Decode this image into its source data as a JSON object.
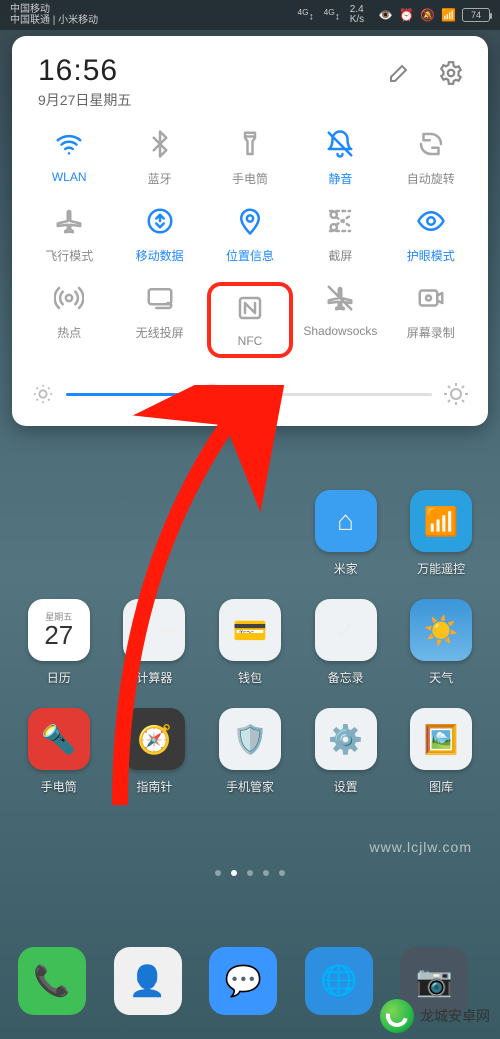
{
  "statusbar": {
    "carrier1": "中国移动",
    "carrier2": "中国联通 | 小米移动",
    "net1": "4G",
    "net2": "4G",
    "speed": "2.4",
    "speed_unit": "K/s",
    "battery": "74"
  },
  "panel": {
    "time": "16:56",
    "date": "9月27日星期五"
  },
  "tiles": [
    {
      "id": "wifi",
      "label": "WLAN",
      "icon": "wifi",
      "active": true
    },
    {
      "id": "bt",
      "label": "蓝牙",
      "icon": "bluetooth",
      "active": false
    },
    {
      "id": "torch",
      "label": "手电筒",
      "icon": "flashlight",
      "active": false
    },
    {
      "id": "mute",
      "label": "静音",
      "icon": "bell-off",
      "active": true
    },
    {
      "id": "rotate",
      "label": "自动旋转",
      "icon": "rotate",
      "active": false
    },
    {
      "id": "airplane",
      "label": "飞行模式",
      "icon": "airplane",
      "active": false
    },
    {
      "id": "data",
      "label": "移动数据",
      "icon": "data",
      "active": true
    },
    {
      "id": "location",
      "label": "位置信息",
      "icon": "location",
      "active": true
    },
    {
      "id": "screenshot",
      "label": "截屏",
      "icon": "scissors",
      "active": false
    },
    {
      "id": "eyecare",
      "label": "护眼模式",
      "icon": "eye",
      "active": true
    },
    {
      "id": "hotspot",
      "label": "热点",
      "icon": "hotspot",
      "active": false
    },
    {
      "id": "cast",
      "label": "无线投屏",
      "icon": "cast",
      "active": false
    },
    {
      "id": "nfc",
      "label": "NFC",
      "icon": "nfc",
      "active": false,
      "highlight": true
    },
    {
      "id": "shadowsocks",
      "label": "Shadowsocks",
      "icon": "plane-off",
      "active": false
    },
    {
      "id": "record",
      "label": "屏幕录制",
      "icon": "record",
      "active": false
    }
  ],
  "brightness": {
    "percent": 40
  },
  "apps_rows": [
    [
      {
        "label": "",
        "color": "transparent"
      },
      {
        "label": "",
        "color": "transparent"
      },
      {
        "label": "",
        "color": "transparent"
      },
      {
        "label": "米家",
        "color": "#3a9ff0",
        "glyph": "⌂"
      },
      {
        "label": "万能遥控",
        "color": "#2aa0e0",
        "glyph": "📶"
      }
    ],
    [
      {
        "label": "日历",
        "color": "#fff",
        "glyph": "27",
        "sub": "星期五"
      },
      {
        "label": "计算器",
        "color": "#eef2f5",
        "glyph": "＋－"
      },
      {
        "label": "钱包",
        "color": "#eef2f5",
        "glyph": "💳"
      },
      {
        "label": "备忘录",
        "color": "#eef2f5",
        "glyph": "✓"
      },
      {
        "label": "天气",
        "color": "linear-gradient(180deg,#3a95d8,#6fb7e8)",
        "glyph": "☀️"
      }
    ],
    [
      {
        "label": "手电筒",
        "color": "#e23b33",
        "glyph": "🔦"
      },
      {
        "label": "指南针",
        "color": "#3a3a3a",
        "glyph": "🧭"
      },
      {
        "label": "手机管家",
        "color": "#eef2f5",
        "glyph": "🛡️"
      },
      {
        "label": "设置",
        "color": "#eef2f5",
        "glyph": "⚙️"
      },
      {
        "label": "图库",
        "color": "#eef2f5",
        "glyph": "🖼️"
      }
    ]
  ],
  "dock": [
    {
      "color": "#3fbf55",
      "glyph": "📞"
    },
    {
      "color": "#f0f0f0",
      "glyph": "👤"
    },
    {
      "color": "#3a95ff",
      "glyph": "💬"
    },
    {
      "color": "#2e8fe0",
      "glyph": "🌐"
    },
    {
      "color": "#495662",
      "glyph": "📷"
    }
  ],
  "watermark": "www.lcjlw.com",
  "brand_text": "龙城安卓网"
}
